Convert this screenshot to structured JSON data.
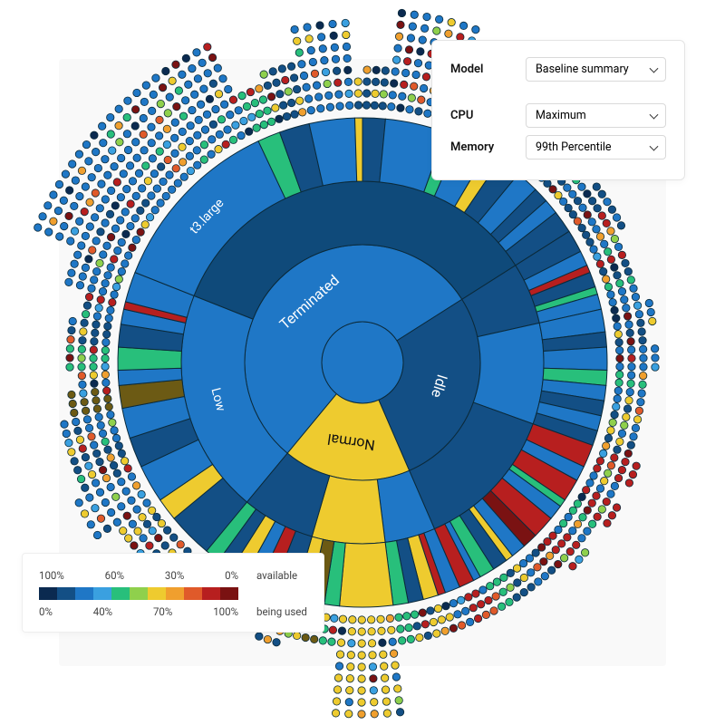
{
  "chart_data": {
    "type": "sunburst",
    "title": "",
    "rings": [
      "state",
      "instance_type",
      "utilization"
    ],
    "data": [
      {
        "name": "Terminated",
        "value": 110,
        "color": "#1f77c6",
        "children": [
          {
            "name": "Low",
            "value": 40,
            "color": "#1f77c6",
            "children": [
              {
                "name": "",
                "value": 6,
                "color": "#134f85"
              },
              {
                "name": "",
                "value": 3,
                "color": "#eecb2f"
              },
              {
                "name": "",
                "value": 5,
                "color": "#1f77c6"
              },
              {
                "name": "",
                "value": 4,
                "color": "#134f85"
              },
              {
                "name": "",
                "value": 4,
                "color": "#1f77c6"
              },
              {
                "name": "",
                "value": 3,
                "color": "#6c5a14"
              },
              {
                "name": "",
                "value": 2,
                "color": "#1f77c6"
              },
              {
                "name": "",
                "value": 3,
                "color": "#28bf7b"
              },
              {
                "name": "",
                "value": 3,
                "color": "#134f85"
              },
              {
                "name": "",
                "value": 2,
                "color": "#1f77c6"
              },
              {
                "name": "",
                "value": 1,
                "color": "#b71f1f"
              },
              {
                "name": "",
                "value": 4,
                "color": "#1f77c6"
              }
            ]
          },
          {
            "name": "",
            "value": 70,
            "color": "#0f4a7a",
            "children": [
              {
                "name": "t3.large",
                "value": 24,
                "color": "#1f77c6"
              },
              {
                "name": "",
                "value": 3,
                "color": "#28bf7b"
              },
              {
                "name": "",
                "value": 4,
                "color": "#134f85"
              },
              {
                "name": "",
                "value": 6,
                "color": "#1f77c6"
              },
              {
                "name": "",
                "value": 1,
                "color": "#eecb2f"
              },
              {
                "name": "",
                "value": 3,
                "color": "#134f85"
              },
              {
                "name": "",
                "value": 8,
                "color": "#1f77c6"
              },
              {
                "name": "",
                "value": 2,
                "color": "#28bf7b"
              },
              {
                "name": "",
                "value": 4,
                "color": "#1f77c6"
              },
              {
                "name": "",
                "value": 2,
                "color": "#eecb2f"
              },
              {
                "name": "",
                "value": 3,
                "color": "#134f85"
              },
              {
                "name": "",
                "value": 3,
                "color": "#1f77c6"
              },
              {
                "name": "",
                "value": 2,
                "color": "#134f85"
              },
              {
                "name": "",
                "value": 2,
                "color": "#1f77c6"
              },
              {
                "name": "",
                "value": 3,
                "color": "#134f85"
              }
            ]
          }
        ]
      },
      {
        "name": "Idle",
        "value": 55,
        "color": "#134f85",
        "children": [
          {
            "name": "",
            "value": 11,
            "color": "#134f85",
            "children": [
              {
                "name": "",
                "value": 3,
                "color": "#134f85"
              },
              {
                "name": "",
                "value": 2,
                "color": "#1f77c6"
              },
              {
                "name": "",
                "value": 1,
                "color": "#b71f1f"
              },
              {
                "name": "",
                "value": 2,
                "color": "#134f85"
              },
              {
                "name": "",
                "value": 1,
                "color": "#28bf7b"
              },
              {
                "name": "",
                "value": 2,
                "color": "#1f77c6"
              }
            ]
          },
          {
            "name": "",
            "value": 18,
            "color": "#1f77c6",
            "children": [
              {
                "name": "",
                "value": 3,
                "color": "#1f77c6"
              },
              {
                "name": "",
                "value": 2,
                "color": "#134f85"
              },
              {
                "name": "",
                "value": 3,
                "color": "#1f77c6"
              },
              {
                "name": "",
                "value": 2,
                "color": "#28bf7b"
              },
              {
                "name": "",
                "value": 2,
                "color": "#1f77c6"
              },
              {
                "name": "",
                "value": 2,
                "color": "#134f85"
              },
              {
                "name": "",
                "value": 2,
                "color": "#1f77c6"
              },
              {
                "name": "",
                "value": 2,
                "color": "#134f85"
              }
            ]
          },
          {
            "name": "",
            "value": 26,
            "color": "#134f85",
            "children": [
              {
                "name": "",
                "value": 3,
                "color": "#b71f1f"
              },
              {
                "name": "",
                "value": 2,
                "color": "#1f77c6"
              },
              {
                "name": "",
                "value": 3,
                "color": "#b71f1f"
              },
              {
                "name": "",
                "value": 1,
                "color": "#28bf7b"
              },
              {
                "name": "",
                "value": 2,
                "color": "#1f77c6"
              },
              {
                "name": "",
                "value": 3,
                "color": "#b71f1f"
              },
              {
                "name": "",
                "value": 2,
                "color": "#7a1212"
              },
              {
                "name": "",
                "value": 2,
                "color": "#1f77c6"
              },
              {
                "name": "",
                "value": 1,
                "color": "#eecb2f"
              },
              {
                "name": "",
                "value": 2,
                "color": "#134f85"
              },
              {
                "name": "",
                "value": 2,
                "color": "#28bf7b"
              },
              {
                "name": "",
                "value": 1,
                "color": "#1f77c6"
              },
              {
                "name": "",
                "value": 2,
                "color": "#b71f1f"
              }
            ]
          }
        ]
      },
      {
        "name": "Normal",
        "value": 35,
        "color": "#eecb2f",
        "children": [
          {
            "name": "",
            "value": 9,
            "color": "#1f77c6",
            "children": [
              {
                "name": "",
                "value": 2,
                "color": "#1f77c6"
              },
              {
                "name": "",
                "value": 1,
                "color": "#b71f1f"
              },
              {
                "name": "",
                "value": 2,
                "color": "#eecb2f"
              },
              {
                "name": "",
                "value": 2,
                "color": "#134f85"
              },
              {
                "name": "",
                "value": 2,
                "color": "#28bf7b"
              }
            ]
          },
          {
            "name": "",
            "value": 13,
            "color": "#eecb2f",
            "children": [
              {
                "name": "",
                "value": 7,
                "color": "#eecb2f"
              },
              {
                "name": "",
                "value": 2,
                "color": "#28bf7b"
              },
              {
                "name": "",
                "value": 2,
                "color": "#6c5a14"
              },
              {
                "name": "",
                "value": 2,
                "color": "#eecb2f"
              }
            ]
          },
          {
            "name": "",
            "value": 13,
            "color": "#134f85",
            "children": [
              {
                "name": "",
                "value": 3,
                "color": "#134f85"
              },
              {
                "name": "",
                "value": 2,
                "color": "#b71f1f"
              },
              {
                "name": "",
                "value": 2,
                "color": "#1f77c6"
              },
              {
                "name": "",
                "value": 2,
                "color": "#eecb2f"
              },
              {
                "name": "",
                "value": 2,
                "color": "#134f85"
              },
              {
                "name": "",
                "value": 2,
                "color": "#28bf7b"
              }
            ]
          }
        ]
      }
    ]
  },
  "controls": {
    "model_label": "Model",
    "model_value": "Baseline summary",
    "cpu_label": "CPU",
    "cpu_value": "Maximum",
    "memory_label": "Memory",
    "memory_value": "99th Percentile"
  },
  "legend": {
    "top_ticks": [
      "100%",
      "60%",
      "30%",
      "0%"
    ],
    "bottom_ticks": [
      "0%",
      "40%",
      "70%",
      "100%"
    ],
    "top_label": "available",
    "bottom_label": "being used",
    "colors": [
      "#0b2a50",
      "#134f85",
      "#1f77c6",
      "#3aa0e0",
      "#28bf7b",
      "#8fd04c",
      "#eecb2f",
      "#f09f2e",
      "#e05a2a",
      "#b71f1f",
      "#7a1212"
    ]
  }
}
